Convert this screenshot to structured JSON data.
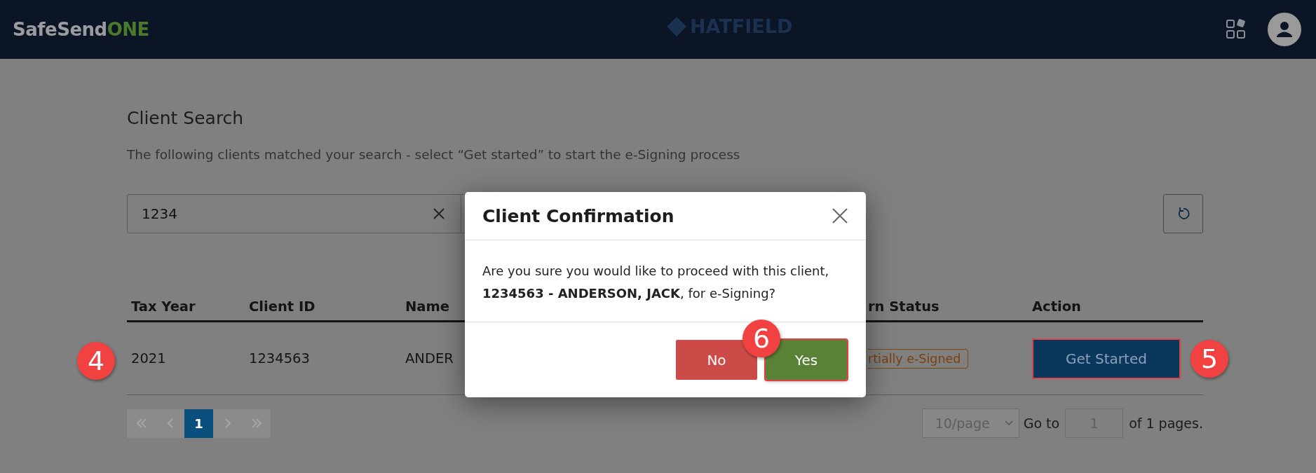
{
  "header": {
    "brand_prefix": "SafeSend",
    "brand_suffix": "ONE",
    "center_logo": "HATFIELD"
  },
  "page": {
    "title": "Client Search",
    "subtitle": "The following clients matched your search - select “Get started” to start the e-Signing process"
  },
  "search": {
    "value": "1234"
  },
  "table": {
    "columns": [
      "Tax Year",
      "Client ID",
      "Name",
      "rn Status",
      "Action"
    ],
    "rows": [
      {
        "tax_year": "2021",
        "client_id": "1234563",
        "name": "ANDER",
        "status": "rtially e-Signed",
        "action": "Get Started",
        "highlighted": true
      }
    ]
  },
  "pagination": {
    "pages": [
      {
        "label": "1",
        "selected": true
      }
    ],
    "page_size": "10/page",
    "go_to_label": "Go to",
    "go_to_value": "1",
    "total": "of 1 pages."
  },
  "dialog": {
    "title": "Client Confirmation",
    "message": "Are you sure you would like to proceed with this client, **1234563 - ANDERSON, JACK**, for e-Signing?",
    "buttons": [
      {
        "label": "No",
        "kind": "no",
        "highlighted": false
      },
      {
        "label": "Yes",
        "kind": "yes",
        "highlighted": true
      }
    ]
  },
  "annotations": [
    {
      "label": "4"
    },
    {
      "label": "5"
    },
    {
      "label": "6"
    }
  ]
}
